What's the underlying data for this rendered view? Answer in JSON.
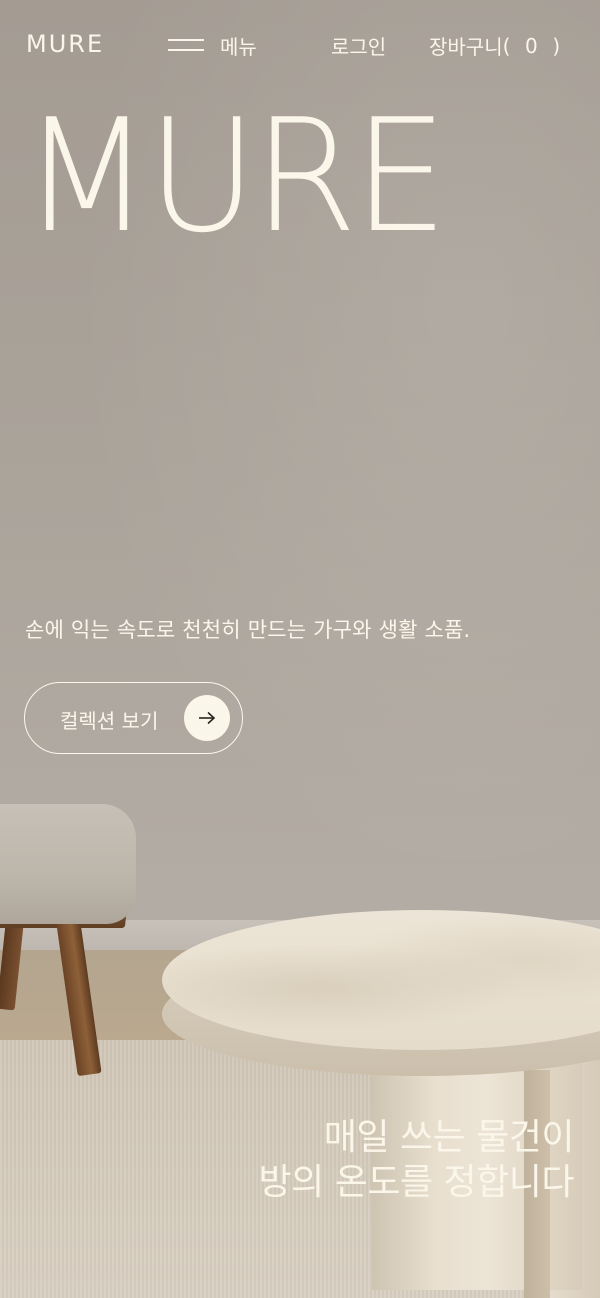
{
  "header": {
    "logo": "MURE",
    "menu_label": "메뉴",
    "login_label": "로그인",
    "cart_label": "장바구니",
    "cart_open": "(",
    "cart_count": "0",
    "cart_close": ")"
  },
  "hero": {
    "title": "MURE",
    "description": "손에 익는 속도로 천천히 만드는 가구와 생활 소품.",
    "cta_label": "컬렉션 보기",
    "tagline_line1": "매일 쓰는 물건이",
    "tagline_line2": "방의 온도를 정합니다"
  },
  "colors": {
    "text": "#fbf6ea",
    "wall": "#a9a299",
    "arrow_button_bg": "#fbf6ea",
    "arrow_icon": "#2a2520"
  },
  "icons": {
    "menu": "hamburger-icon",
    "cta": "arrow-right-icon"
  }
}
